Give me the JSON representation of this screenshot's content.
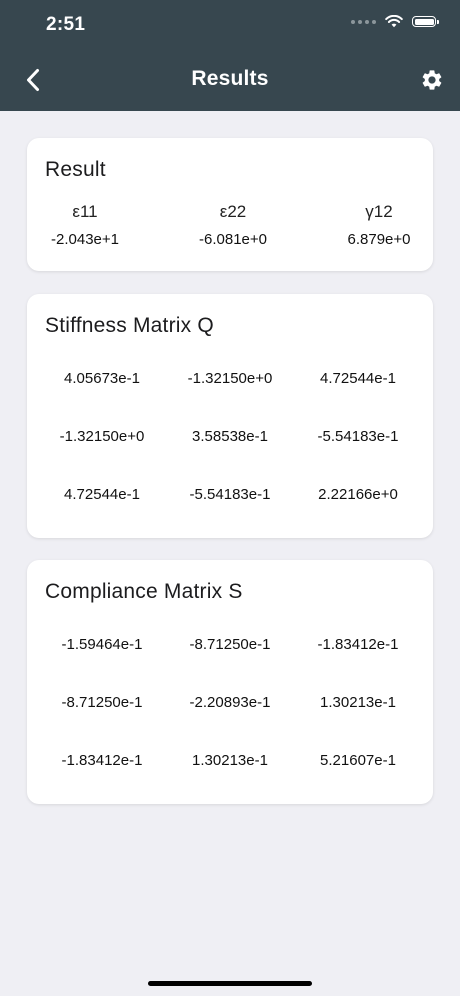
{
  "status_bar": {
    "time": "2:51"
  },
  "nav": {
    "title": "Results",
    "back_icon": "chevron-left-icon",
    "settings_icon": "gear-icon"
  },
  "result": {
    "title": "Result",
    "strains": [
      {
        "label": "ε11",
        "value": "-2.043e+1"
      },
      {
        "label": "ε22",
        "value": "-6.081e+0"
      },
      {
        "label": "γ12",
        "value": "6.879e+0"
      }
    ]
  },
  "stiffness": {
    "title": "Stiffness Matrix Q",
    "rows": [
      [
        "4.05673e-1",
        "-1.32150e+0",
        "4.72544e-1"
      ],
      [
        "-1.32150e+0",
        "3.58538e-1",
        "-5.54183e-1"
      ],
      [
        "4.72544e-1",
        "-5.54183e-1",
        "2.22166e+0"
      ]
    ]
  },
  "compliance": {
    "title": "Compliance Matrix S",
    "rows": [
      [
        "-1.59464e-1",
        "-8.71250e-1",
        "-1.83412e-1"
      ],
      [
        "-8.71250e-1",
        "-2.20893e-1",
        "1.30213e-1"
      ],
      [
        "-1.83412e-1",
        "1.30213e-1",
        "5.21607e-1"
      ]
    ]
  },
  "colors": {
    "header": "#37474f",
    "background": "#efeff4",
    "card": "#ffffff"
  }
}
